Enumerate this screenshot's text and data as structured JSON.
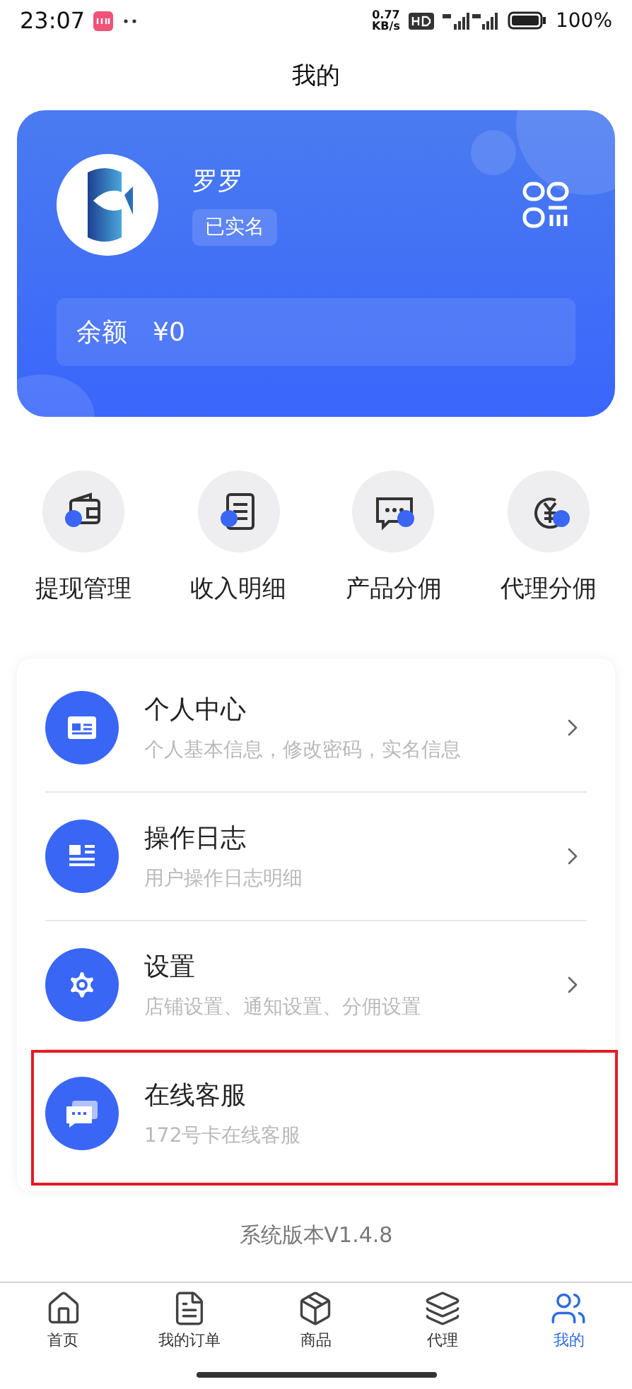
{
  "status_bar": {
    "time": "23:07",
    "speed": "0.77\nKB/s",
    "battery": "100%"
  },
  "header": {
    "title": "我的"
  },
  "profile": {
    "name": "罗罗",
    "verified_badge": "已实名",
    "balance_label": "余额",
    "balance": "¥0"
  },
  "quick_actions": [
    {
      "label": "提现管理",
      "kind": "wallet"
    },
    {
      "label": "收入明细",
      "kind": "clipboard"
    },
    {
      "label": "产品分佣",
      "kind": "chat"
    },
    {
      "label": "代理分佣",
      "kind": "coin"
    }
  ],
  "menu": [
    {
      "title": "个人中心",
      "subtitle": "个人基本信息，修改密码，实名信息",
      "kind": "card",
      "chevron": true,
      "highlighted": false
    },
    {
      "title": "操作日志",
      "subtitle": "用户操作日志明细",
      "kind": "log",
      "chevron": true,
      "highlighted": false
    },
    {
      "title": "设置",
      "subtitle": "店铺设置、通知设置、分佣设置",
      "kind": "gear",
      "chevron": true,
      "highlighted": false
    },
    {
      "title": "在线客服",
      "subtitle": "172号卡在线客服",
      "kind": "service",
      "chevron": false,
      "highlighted": true
    }
  ],
  "version": "系统版本V1.4.8",
  "tabs": [
    {
      "label": "首页",
      "kind": "home",
      "selected": false
    },
    {
      "label": "我的订单",
      "kind": "doc",
      "selected": false
    },
    {
      "label": "商品",
      "kind": "box",
      "selected": false
    },
    {
      "label": "代理",
      "kind": "layers",
      "selected": false
    },
    {
      "label": "我的",
      "kind": "users",
      "selected": true
    }
  ]
}
